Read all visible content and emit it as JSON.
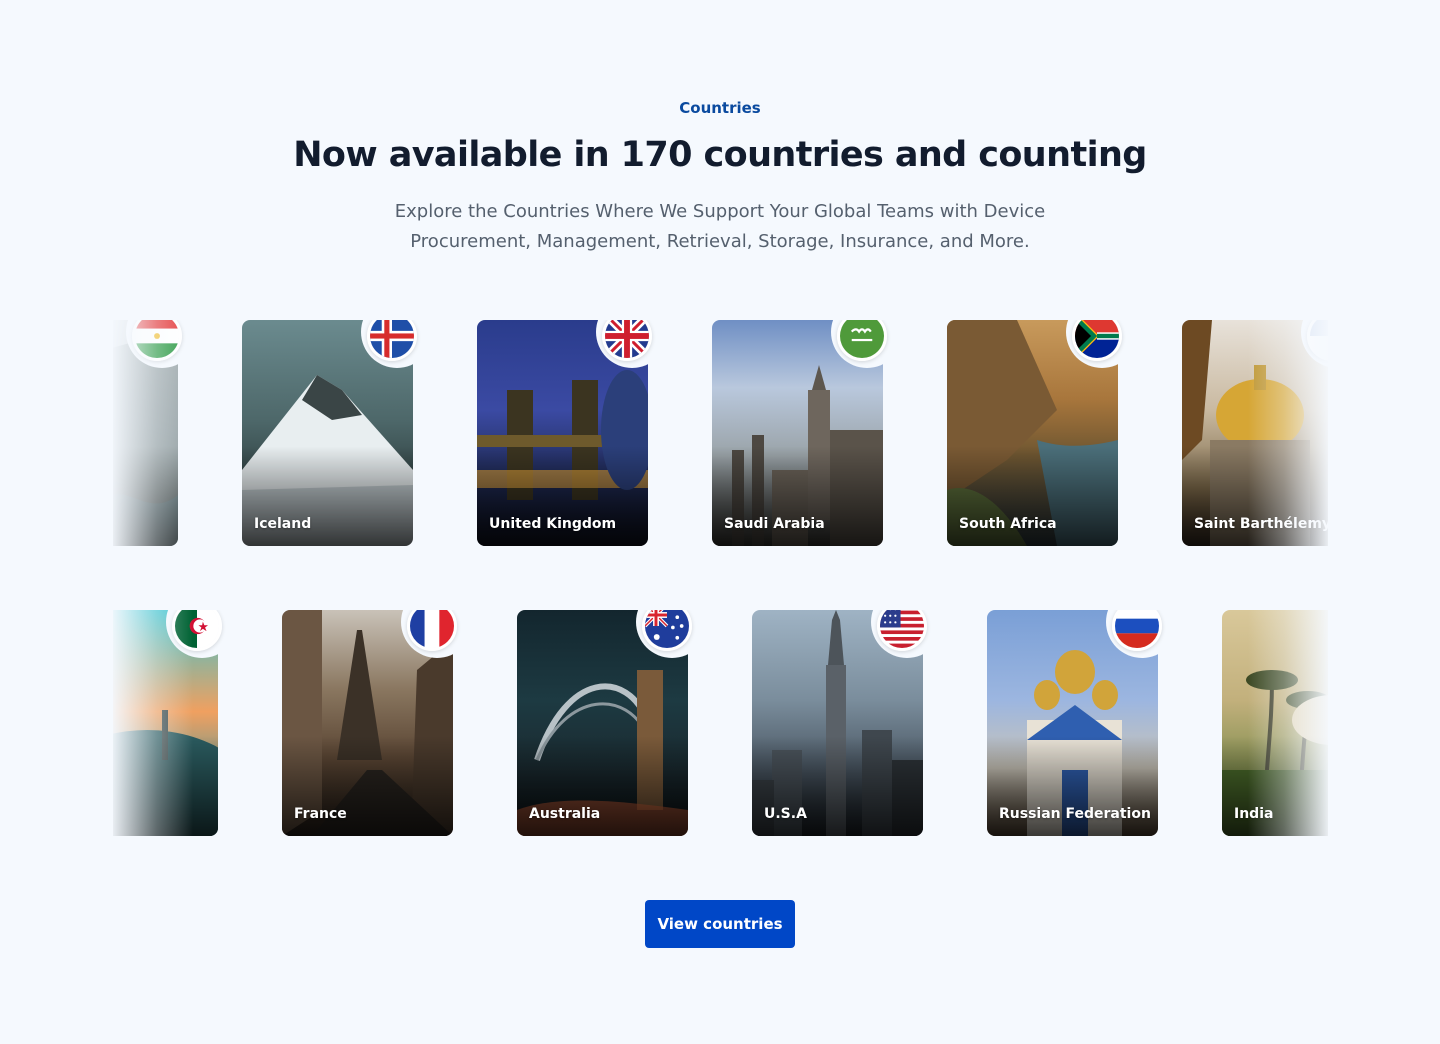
{
  "section": {
    "eyebrow": "Countries",
    "title": "Now available in 170 countries and counting",
    "subtitle": "Explore the Countries Where We Support Your Global Teams with Device Procurement, Management, Retrieval, Storage, Insurance, and More."
  },
  "carousel_row_1": {
    "cards": [
      {
        "label": "",
        "flag": "tajikistan-flag-icon"
      },
      {
        "label": "Iceland",
        "flag": "iceland-flag-icon"
      },
      {
        "label": "United Kingdom",
        "flag": "uk-flag-icon"
      },
      {
        "label": "Saudi Arabia",
        "flag": "saudi-arabia-flag-icon"
      },
      {
        "label": "South Africa",
        "flag": "south-africa-flag-icon"
      },
      {
        "label": "Saint Barthélemy",
        "flag": "saint-barthelemy-flag-icon"
      }
    ]
  },
  "carousel_row_2": {
    "cards": [
      {
        "label": "",
        "flag": "algeria-flag-icon"
      },
      {
        "label": "France",
        "flag": "france-flag-icon"
      },
      {
        "label": "Australia",
        "flag": "australia-flag-icon"
      },
      {
        "label": "U.S.A",
        "flag": "usa-flag-icon"
      },
      {
        "label": "Russian Federation",
        "flag": "russia-flag-icon"
      },
      {
        "label": "India",
        "flag": "india-flag-icon"
      }
    ]
  },
  "cta": {
    "label": "View countries"
  },
  "colors": {
    "background": "#f5f9fe",
    "eyebrow": "#0a4a9f",
    "heading": "#121c2e",
    "body_text": "#55606e",
    "button": "#0047c7"
  }
}
